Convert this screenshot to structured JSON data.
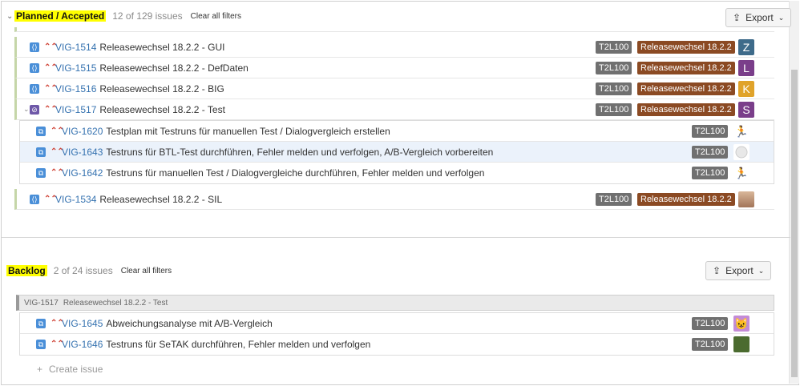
{
  "planned": {
    "title": "Planned / Accepted",
    "count": "12 of 129 issues",
    "clear_filters": "Clear all filters",
    "export_label": "Export",
    "rows": [
      {
        "key": "VIG-1514",
        "summary": "Releasewechsel 18.2.2 - GUI",
        "version": "T2L100",
        "release": "Releasewechsel 18.2.2",
        "assignee": "Z"
      },
      {
        "key": "VIG-1515",
        "summary": "Releasewechsel 18.2.2 - DefDaten",
        "version": "T2L100",
        "release": "Releasewechsel 18.2.2",
        "assignee": "L"
      },
      {
        "key": "VIG-1516",
        "summary": "Releasewechsel 18.2.2 - BIG",
        "version": "T2L100",
        "release": "Releasewechsel 18.2.2",
        "assignee": "K"
      },
      {
        "key": "VIG-1517",
        "summary": "Releasewechsel 18.2.2 - Test",
        "version": "T2L100",
        "release": "Releasewechsel 18.2.2",
        "assignee": "S"
      }
    ],
    "subtasks": [
      {
        "key": "VIG-1620",
        "summary": "Testplan mit Testruns für manuellen Test / Dialogvergleich erstellen",
        "version": "T2L100"
      },
      {
        "key": "VIG-1643",
        "summary": "Testruns für BTL-Test durchführen, Fehler melden und verfolgen, A/B-Vergleich vorbereiten",
        "version": "T2L100"
      },
      {
        "key": "VIG-1642",
        "summary": "Testruns für manuellen Test / Dialogvergleiche durchführen, Fehler melden und verfolgen",
        "version": "T2L100"
      }
    ],
    "last_row": {
      "key": "VIG-1534",
      "summary": "Releasewechsel 18.2.2 - SIL",
      "version": "T2L100",
      "release": "Releasewechsel 18.2.2"
    }
  },
  "backlog": {
    "title": "Backlog",
    "count": "2 of 24 issues",
    "clear_filters": "Clear all filters",
    "export_label": "Export",
    "group": {
      "key": "VIG-1517",
      "summary": "Releasewechsel 18.2.2 - Test"
    },
    "rows": [
      {
        "key": "VIG-1645",
        "summary": "Abweichungsanalyse mit A/B-Vergleich",
        "version": "T2L100"
      },
      {
        "key": "VIG-1646",
        "summary": "Testruns für SeTAK durchführen, Fehler melden und verfolgen",
        "version": "T2L100"
      }
    ],
    "create_issue": "Create issue"
  },
  "colors": {
    "highlight": "#ffff00",
    "link": "#3572b0",
    "release_badge": "#8b4a23",
    "version_badge": "#707070",
    "priority": "#d04437"
  },
  "icons": {
    "story": "story-icon",
    "subtask": "subtask-icon",
    "test": "test-icon",
    "priority": "priority-high-icon",
    "export": "export-icon"
  }
}
